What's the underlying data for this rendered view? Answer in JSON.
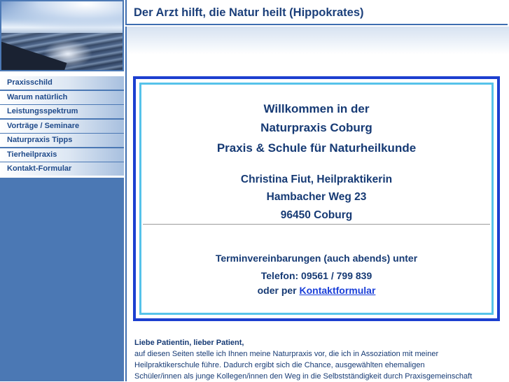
{
  "header": {
    "title": "Der Arzt hilft, die Natur heilt (Hippokrates)"
  },
  "nav": [
    {
      "label": "Praxisschild"
    },
    {
      "label": "Warum natürlich"
    },
    {
      "label": "Leistungsspektrum"
    },
    {
      "label": "Vorträge / Seminare"
    },
    {
      "label": "Naturpraxis Tipps"
    },
    {
      "label": "Tierheilpraxis"
    },
    {
      "label": "Kontakt-Formular"
    }
  ],
  "box": {
    "welcome": "Willkommen in der",
    "practice": "Naturpraxis Coburg",
    "school": "Praxis & Schule für Naturheilkunde",
    "name": "Christina Fiut, Heilpraktikerin",
    "street": "Hambacher Weg 23",
    "city": "96450 Coburg",
    "appointments": "Terminvereinbarungen (auch abends) unter",
    "phone": "Telefon:  09561 / 799 839",
    "or_by": "oder per",
    "contact_link": "Kontaktformular"
  },
  "intro": {
    "greeting": "Liebe Patientin, lieber Patient,",
    "line1": "auf diesen Seiten stelle ich Ihnen meine Naturpraxis vor, die ich in Assoziation mit meiner",
    "line2": "Heilpraktikerschule führe. Dadurch ergibt sich die Chance, ausgewählten ehemaligen",
    "line3": "Schüler/innen als junge Kollegen/innen den Weg in die Selbstständigkeit durch Praxisgemeinschaft"
  },
  "colors": {
    "nav_bg": "#4b78b4",
    "title_text": "#1b3f7a",
    "box_border_outer": "#1c3fd0",
    "box_border_inner": "#56c3ea",
    "link": "#1a3fd8"
  }
}
